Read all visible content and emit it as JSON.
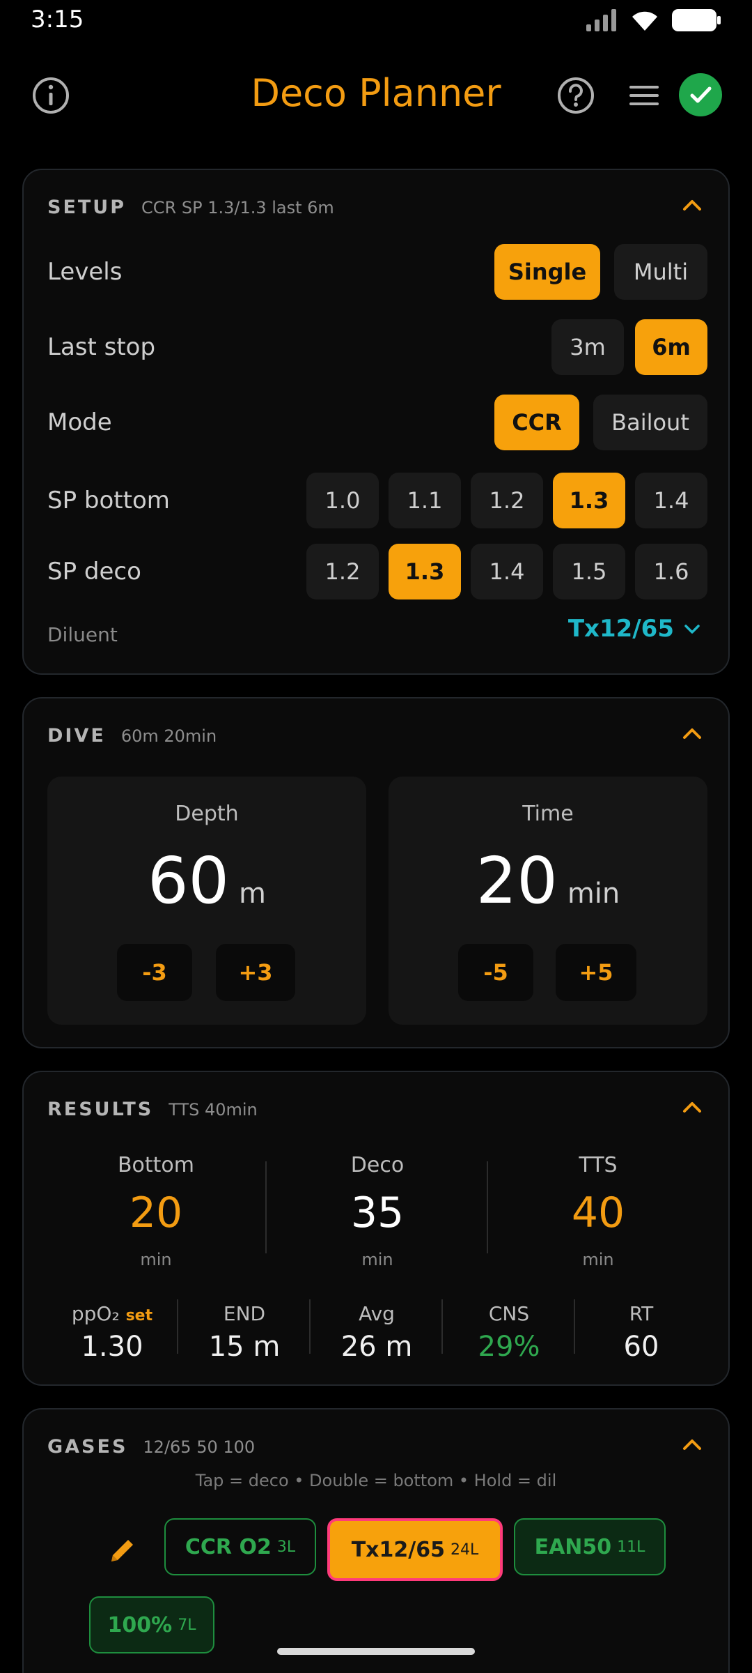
{
  "status": {
    "time": "3:15"
  },
  "app": {
    "title": "Deco Planner"
  },
  "setup": {
    "heading": "SETUP",
    "summary": "CCR SP 1.3/1.3 last 6m",
    "levels": {
      "label": "Levels",
      "options": [
        "Single",
        "Multi"
      ],
      "selected": "Single"
    },
    "last_stop": {
      "label": "Last stop",
      "options": [
        "3m",
        "6m"
      ],
      "selected": "6m"
    },
    "mode": {
      "label": "Mode",
      "options": [
        "CCR",
        "Bailout"
      ],
      "selected": "CCR"
    },
    "sp_bottom": {
      "label": "SP bottom",
      "options": [
        "1.0",
        "1.1",
        "1.2",
        "1.3",
        "1.4"
      ],
      "selected": "1.3"
    },
    "sp_deco": {
      "label": "SP deco",
      "options": [
        "1.2",
        "1.3",
        "1.4",
        "1.5",
        "1.6"
      ],
      "selected": "1.3"
    },
    "diluent": {
      "label": "Diluent",
      "value": "Tx12/65"
    }
  },
  "dive": {
    "heading": "DIVE",
    "summary": "60m 20min",
    "depth": {
      "label": "Depth",
      "value": "60",
      "unit": "m",
      "minus": "-3",
      "plus": "+3"
    },
    "time": {
      "label": "Time",
      "value": "20",
      "unit": "min",
      "minus": "-5",
      "plus": "+5"
    }
  },
  "results": {
    "heading": "RESULTS",
    "summary": "TTS 40min",
    "bottom": {
      "label": "Bottom",
      "value": "20",
      "unit": "min"
    },
    "deco": {
      "label": "Deco",
      "value": "35",
      "unit": "min"
    },
    "tts": {
      "label": "TTS",
      "value": "40",
      "unit": "min"
    },
    "ppo2": {
      "label": "ppO₂",
      "tag": "set",
      "value": "1.30"
    },
    "end": {
      "label": "END",
      "value": "15 m"
    },
    "avg": {
      "label": "Avg",
      "value": "26 m"
    },
    "cns": {
      "label": "CNS",
      "value": "29%"
    },
    "rt": {
      "label": "RT",
      "value": "60"
    }
  },
  "gases": {
    "heading": "GASES",
    "summary": "12/65 50 100",
    "hint": "Tap = deco • Double = bottom • Hold = dil",
    "chips": [
      {
        "name": "CCR O2",
        "size": "3L"
      },
      {
        "name": "Tx12/65",
        "size": "24L"
      },
      {
        "name": "EAN50",
        "size": "11L"
      },
      {
        "name": "100%",
        "size": "7L"
      }
    ]
  },
  "colors": {
    "accent": "#f7a10c",
    "green": "#2fa84f",
    "cyan": "#1fb8c9",
    "selected_border": "#ff3b7a"
  }
}
